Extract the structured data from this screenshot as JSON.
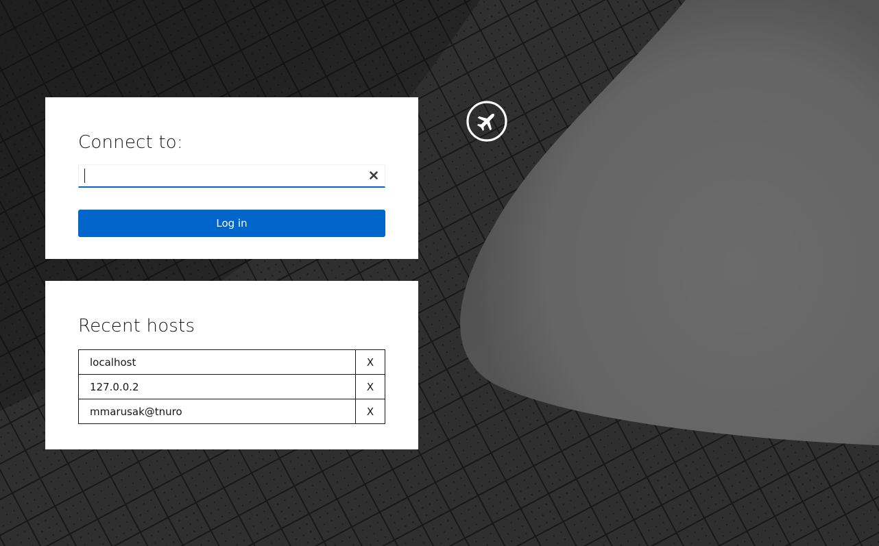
{
  "login": {
    "heading": "Connect to:",
    "input_value": "",
    "clear_icon": "close-icon",
    "button_label": "Log in"
  },
  "recent": {
    "heading": "Recent hosts",
    "hosts": [
      {
        "name": "localhost",
        "remove_label": "X"
      },
      {
        "name": "127.0.0.2",
        "remove_label": "X"
      },
      {
        "name": "mmarusak@tnuro",
        "remove_label": "X"
      }
    ]
  },
  "brand": {
    "icon": "plane-icon"
  },
  "colors": {
    "accent": "#0066cc",
    "panel": "#ffffff",
    "text": "#151515"
  }
}
